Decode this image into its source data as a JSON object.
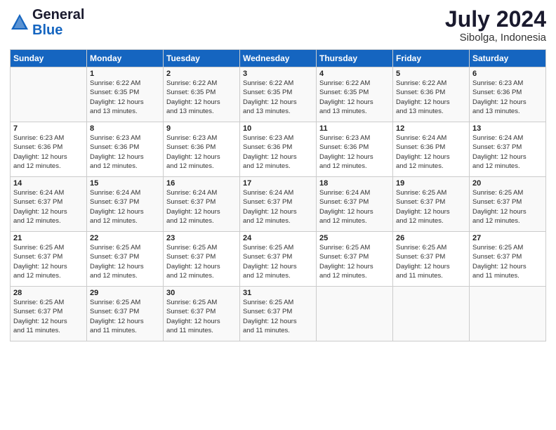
{
  "header": {
    "logo_general": "General",
    "logo_blue": "Blue",
    "month_title": "July 2024",
    "subtitle": "Sibolga, Indonesia"
  },
  "days_of_week": [
    "Sunday",
    "Monday",
    "Tuesday",
    "Wednesday",
    "Thursday",
    "Friday",
    "Saturday"
  ],
  "weeks": [
    [
      {
        "day": "",
        "info": ""
      },
      {
        "day": "1",
        "info": "Sunrise: 6:22 AM\nSunset: 6:35 PM\nDaylight: 12 hours\nand 13 minutes."
      },
      {
        "day": "2",
        "info": "Sunrise: 6:22 AM\nSunset: 6:35 PM\nDaylight: 12 hours\nand 13 minutes."
      },
      {
        "day": "3",
        "info": "Sunrise: 6:22 AM\nSunset: 6:35 PM\nDaylight: 12 hours\nand 13 minutes."
      },
      {
        "day": "4",
        "info": "Sunrise: 6:22 AM\nSunset: 6:35 PM\nDaylight: 12 hours\nand 13 minutes."
      },
      {
        "day": "5",
        "info": "Sunrise: 6:22 AM\nSunset: 6:36 PM\nDaylight: 12 hours\nand 13 minutes."
      },
      {
        "day": "6",
        "info": "Sunrise: 6:23 AM\nSunset: 6:36 PM\nDaylight: 12 hours\nand 13 minutes."
      }
    ],
    [
      {
        "day": "7",
        "info": "Sunrise: 6:23 AM\nSunset: 6:36 PM\nDaylight: 12 hours\nand 12 minutes."
      },
      {
        "day": "8",
        "info": "Sunrise: 6:23 AM\nSunset: 6:36 PM\nDaylight: 12 hours\nand 12 minutes."
      },
      {
        "day": "9",
        "info": "Sunrise: 6:23 AM\nSunset: 6:36 PM\nDaylight: 12 hours\nand 12 minutes."
      },
      {
        "day": "10",
        "info": "Sunrise: 6:23 AM\nSunset: 6:36 PM\nDaylight: 12 hours\nand 12 minutes."
      },
      {
        "day": "11",
        "info": "Sunrise: 6:23 AM\nSunset: 6:36 PM\nDaylight: 12 hours\nand 12 minutes."
      },
      {
        "day": "12",
        "info": "Sunrise: 6:24 AM\nSunset: 6:36 PM\nDaylight: 12 hours\nand 12 minutes."
      },
      {
        "day": "13",
        "info": "Sunrise: 6:24 AM\nSunset: 6:37 PM\nDaylight: 12 hours\nand 12 minutes."
      }
    ],
    [
      {
        "day": "14",
        "info": "Sunrise: 6:24 AM\nSunset: 6:37 PM\nDaylight: 12 hours\nand 12 minutes."
      },
      {
        "day": "15",
        "info": "Sunrise: 6:24 AM\nSunset: 6:37 PM\nDaylight: 12 hours\nand 12 minutes."
      },
      {
        "day": "16",
        "info": "Sunrise: 6:24 AM\nSunset: 6:37 PM\nDaylight: 12 hours\nand 12 minutes."
      },
      {
        "day": "17",
        "info": "Sunrise: 6:24 AM\nSunset: 6:37 PM\nDaylight: 12 hours\nand 12 minutes."
      },
      {
        "day": "18",
        "info": "Sunrise: 6:24 AM\nSunset: 6:37 PM\nDaylight: 12 hours\nand 12 minutes."
      },
      {
        "day": "19",
        "info": "Sunrise: 6:25 AM\nSunset: 6:37 PM\nDaylight: 12 hours\nand 12 minutes."
      },
      {
        "day": "20",
        "info": "Sunrise: 6:25 AM\nSunset: 6:37 PM\nDaylight: 12 hours\nand 12 minutes."
      }
    ],
    [
      {
        "day": "21",
        "info": "Sunrise: 6:25 AM\nSunset: 6:37 PM\nDaylight: 12 hours\nand 12 minutes."
      },
      {
        "day": "22",
        "info": "Sunrise: 6:25 AM\nSunset: 6:37 PM\nDaylight: 12 hours\nand 12 minutes."
      },
      {
        "day": "23",
        "info": "Sunrise: 6:25 AM\nSunset: 6:37 PM\nDaylight: 12 hours\nand 12 minutes."
      },
      {
        "day": "24",
        "info": "Sunrise: 6:25 AM\nSunset: 6:37 PM\nDaylight: 12 hours\nand 12 minutes."
      },
      {
        "day": "25",
        "info": "Sunrise: 6:25 AM\nSunset: 6:37 PM\nDaylight: 12 hours\nand 12 minutes."
      },
      {
        "day": "26",
        "info": "Sunrise: 6:25 AM\nSunset: 6:37 PM\nDaylight: 12 hours\nand 11 minutes."
      },
      {
        "day": "27",
        "info": "Sunrise: 6:25 AM\nSunset: 6:37 PM\nDaylight: 12 hours\nand 11 minutes."
      }
    ],
    [
      {
        "day": "28",
        "info": "Sunrise: 6:25 AM\nSunset: 6:37 PM\nDaylight: 12 hours\nand 11 minutes."
      },
      {
        "day": "29",
        "info": "Sunrise: 6:25 AM\nSunset: 6:37 PM\nDaylight: 12 hours\nand 11 minutes."
      },
      {
        "day": "30",
        "info": "Sunrise: 6:25 AM\nSunset: 6:37 PM\nDaylight: 12 hours\nand 11 minutes."
      },
      {
        "day": "31",
        "info": "Sunrise: 6:25 AM\nSunset: 6:37 PM\nDaylight: 12 hours\nand 11 minutes."
      },
      {
        "day": "",
        "info": ""
      },
      {
        "day": "",
        "info": ""
      },
      {
        "day": "",
        "info": ""
      }
    ]
  ]
}
